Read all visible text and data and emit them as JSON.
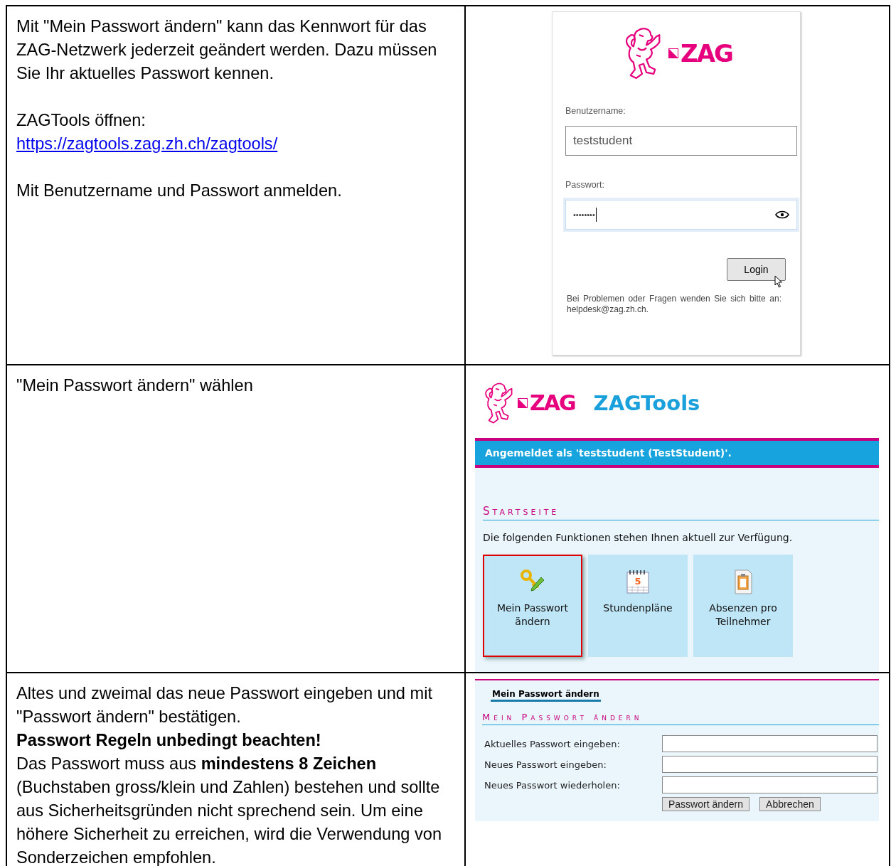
{
  "step_1": {
    "instructions": [
      {
        "kind": "paragraph",
        "text": "Mit \"Mein Passwort ändern\" kann das Kennwort für das ZAG-Netzwerk jederzeit geändert werden. Dazu müssen Sie Ihr aktuelles Passwort kennen."
      },
      {
        "kind": "paragraph",
        "text": "ZAGTools öffnen:",
        "link": "https://zagtools.zag.zh.ch/zagtools/"
      },
      {
        "kind": "paragraph",
        "text": "Mit Benutzername und Passwort anmelden."
      }
    ],
    "login_screen": {
      "logo": "ZAG",
      "username_label": "Benutzername:",
      "username_value": "teststudent",
      "password_label": "Passwort:",
      "password_value": "••••••••",
      "password_focused": true,
      "login_button": "Login",
      "help_text": "Bei Problemen oder Fragen wenden Sie sich bitte an: helpdesk@zag.zh.ch."
    }
  },
  "step_2": {
    "instructions": [
      {
        "kind": "paragraph",
        "text": "\"Mein Passwort ändern\" wählen"
      }
    ],
    "zagtools_screen": {
      "logo": "ZAG",
      "app_title": "ZAGTools",
      "login_banner": "Angemeldet als 'teststudent (TestStudent)'.",
      "section_title": "Startseite",
      "intro": "Die folgenden Funktionen stehen Ihnen aktuell zur Verfügung.",
      "tiles": [
        {
          "kind": "key",
          "label": "Mein Passwort ändern",
          "selected": true
        },
        {
          "kind": "calendar",
          "label": "Stundenpläne",
          "icon_text": "5",
          "selected": false
        },
        {
          "kind": "clipboard",
          "label": "Absenzen pro Teilnehmer",
          "selected": false
        }
      ]
    }
  },
  "step_3": {
    "instructions": [
      {
        "kind": "paragraph",
        "text": "Altes und zweimal das neue Passwort eingeben und mit \"Passwort ändern\" bestätigen."
      },
      {
        "kind": "bold",
        "text": "Passwort Regeln unbedingt beachten!"
      },
      {
        "kind": "paragraph",
        "text": "Das Passwort muss aus **mindestens 8 Zeichen** (Buchstaben gross/klein und Zahlen) bestehen und sollte aus Sicherheitsgründen nicht sprechend sein. Um eine höhere Sicherheit zu erreichen, wird die Verwendung von Sonderzeichen empfohlen."
      }
    ],
    "password_screen": {
      "tabs": [
        {
          "label": "Mein Passwort ändern",
          "selected": true
        }
      ],
      "section_title": "Mein Passwort ändern",
      "fields": [
        {
          "label": "Aktuelles Passwort eingeben:"
        },
        {
          "label": "Neues Passwort eingeben:"
        },
        {
          "label": "Neues Passwort wiederholen:"
        }
      ],
      "buttons": [
        "Passwort ändern",
        "Abbrechen"
      ]
    }
  }
}
